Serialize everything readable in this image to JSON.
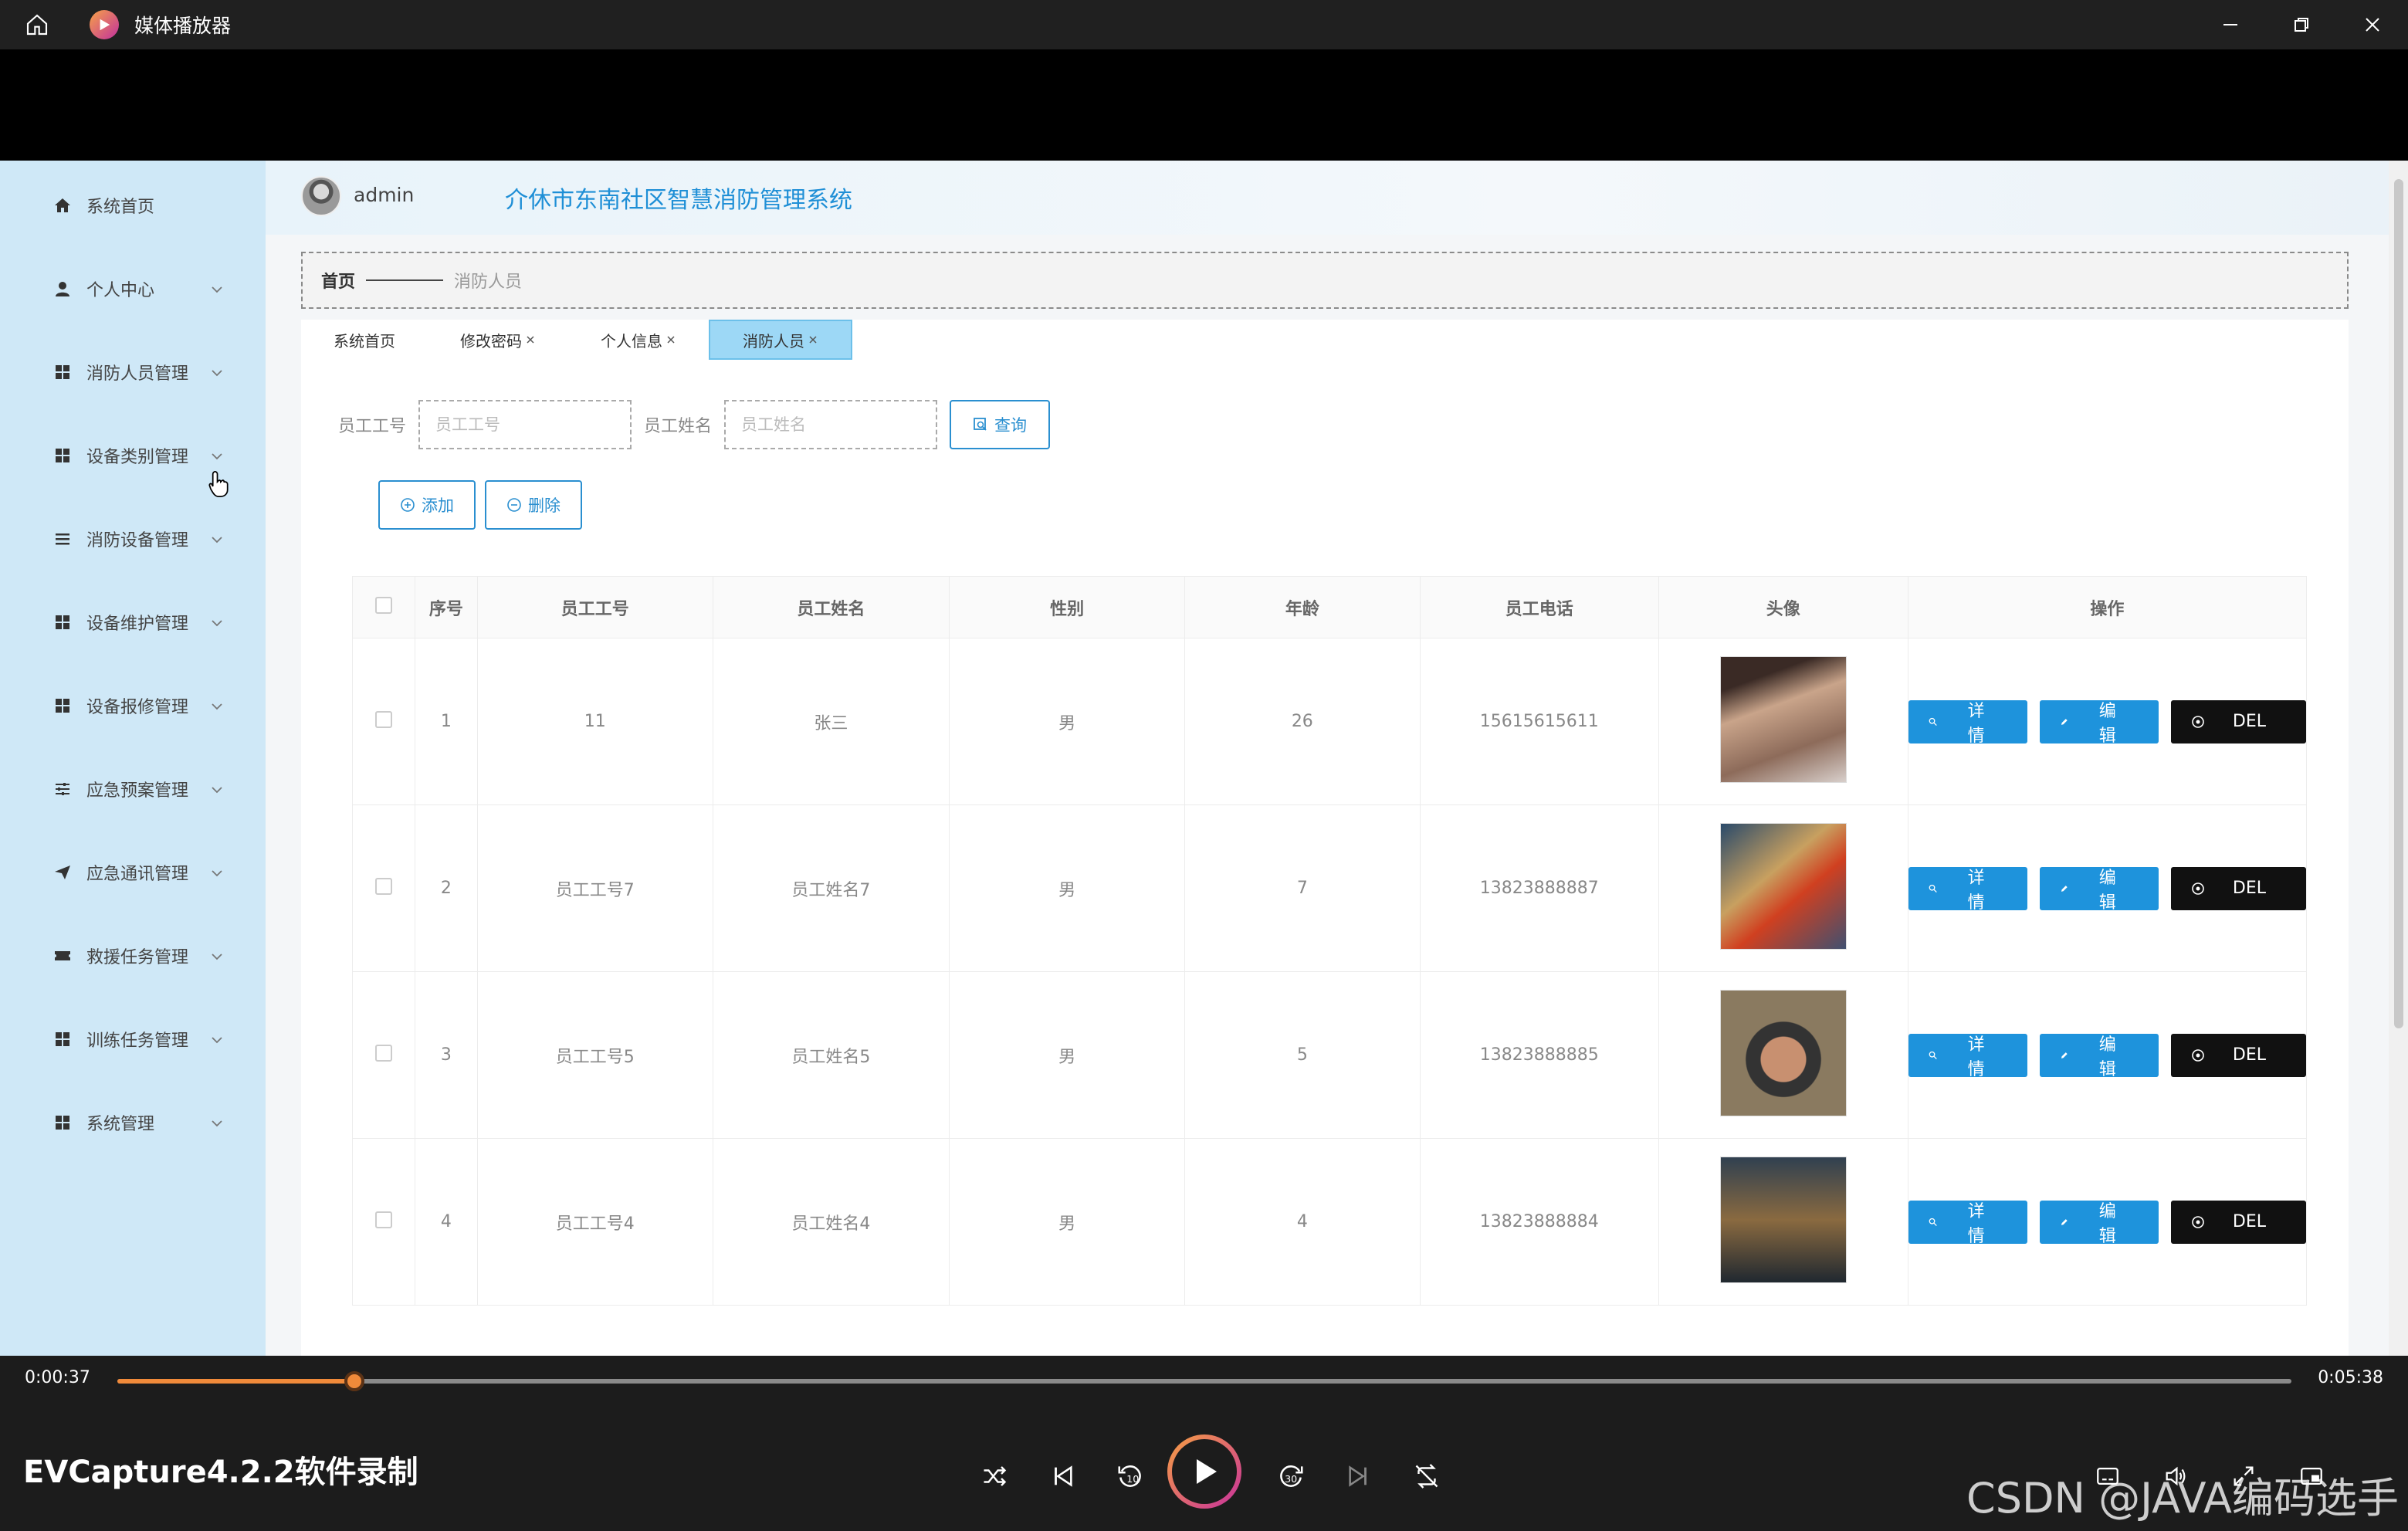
{
  "player": {
    "title": "媒体播放器",
    "current_time": "0:00:37",
    "total_time": "0:05:38",
    "progress_fraction": 0.109,
    "recorder_label": "EVCapture4.2.2软件录制",
    "watermark": "CSDN @JAVA编码选手"
  },
  "app": {
    "username": "admin",
    "system_title": "介休市东南社区智慧消防管理系统",
    "breadcrumb": {
      "home": "首页",
      "current": "消防人员"
    }
  },
  "sidebar": {
    "items": [
      {
        "label": "系统首页",
        "icon": "home-icon",
        "has_children": false
      },
      {
        "label": "个人中心",
        "icon": "user-icon",
        "has_children": true
      },
      {
        "label": "消防人员管理",
        "icon": "grid-icon",
        "has_children": true
      },
      {
        "label": "设备类别管理",
        "icon": "grid-icon",
        "has_children": true
      },
      {
        "label": "消防设备管理",
        "icon": "list-icon",
        "has_children": true
      },
      {
        "label": "设备维护管理",
        "icon": "grid-icon",
        "has_children": true
      },
      {
        "label": "设备报修管理",
        "icon": "grid-icon",
        "has_children": true
      },
      {
        "label": "应急预案管理",
        "icon": "sliders-icon",
        "has_children": true
      },
      {
        "label": "应急通讯管理",
        "icon": "send-icon",
        "has_children": true
      },
      {
        "label": "救援任务管理",
        "icon": "ticket-icon",
        "has_children": true
      },
      {
        "label": "训练任务管理",
        "icon": "grid-icon",
        "has_children": true
      },
      {
        "label": "系统管理",
        "icon": "grid-icon",
        "has_children": true
      }
    ]
  },
  "tabs": [
    {
      "label": "系统首页",
      "closable": false,
      "active": false
    },
    {
      "label": "修改密码",
      "closable": true,
      "active": false
    },
    {
      "label": "个人信息",
      "closable": true,
      "active": false
    },
    {
      "label": "消防人员",
      "closable": true,
      "active": true
    }
  ],
  "search": {
    "id_label": "员工工号",
    "id_placeholder": "员工工号",
    "name_label": "员工姓名",
    "name_placeholder": "员工姓名",
    "query_button": "查询"
  },
  "actions": {
    "add": "添加",
    "delete": "删除"
  },
  "table": {
    "headers": [
      "序号",
      "员工工号",
      "员工姓名",
      "性别",
      "年龄",
      "员工电话",
      "头像",
      "操作"
    ],
    "rows": [
      {
        "index": "1",
        "emp_id": "11",
        "name": "张三",
        "gender": "男",
        "age": "26",
        "phone": "15615615611"
      },
      {
        "index": "2",
        "emp_id": "员工工号7",
        "name": "员工姓名7",
        "gender": "男",
        "age": "7",
        "phone": "13823888887"
      },
      {
        "index": "3",
        "emp_id": "员工工号5",
        "name": "员工姓名5",
        "gender": "男",
        "age": "5",
        "phone": "13823888885"
      },
      {
        "index": "4",
        "emp_id": "员工工号4",
        "name": "员工姓名4",
        "gender": "男",
        "age": "4",
        "phone": "13823888884"
      }
    ],
    "row_buttons": {
      "detail": "详情",
      "edit": "编辑",
      "del": "DEL"
    }
  },
  "colors": {
    "sidebar_bg": "#cfe8f7",
    "accent_blue": "#1e93dc",
    "title_blue": "#1f8fd6",
    "progress_orange": "#f08a3a"
  }
}
